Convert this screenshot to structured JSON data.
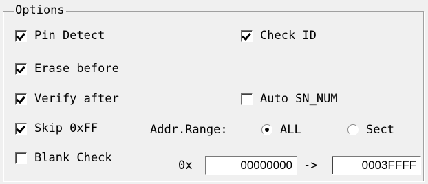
{
  "options_group": {
    "title": "Options",
    "pin_detect": {
      "label": "Pin Detect",
      "checked": true
    },
    "check_id": {
      "label": "Check ID",
      "checked": true
    },
    "erase_before": {
      "label": "Erase before",
      "checked": true
    },
    "verify_after": {
      "label": "Verify after",
      "checked": true
    },
    "auto_sn_num": {
      "label": "Auto SN_NUM",
      "checked": false
    },
    "skip_0xff": {
      "label": "Skip 0xFF",
      "checked": true
    },
    "blank_check": {
      "label": "Blank Check",
      "checked": false
    },
    "addr_range": {
      "label": "Addr.Range:",
      "all_label": "ALL",
      "sect_label": "Sect",
      "selected": "ALL"
    },
    "address": {
      "prefix": "0x",
      "start": "00000000",
      "arrow": "->",
      "end": "0003FFFF"
    }
  }
}
